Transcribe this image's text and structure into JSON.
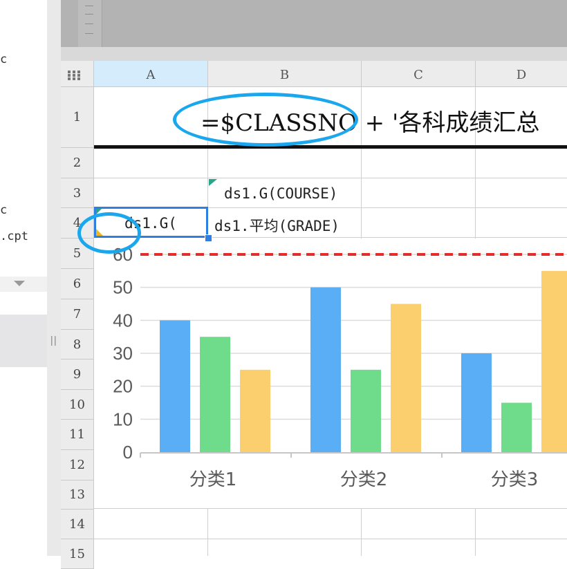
{
  "left_panel": {
    "text_fragments": [
      "c",
      "c",
      ".cpt"
    ]
  },
  "grid": {
    "columns": [
      "A",
      "B",
      "C",
      "D"
    ],
    "rows": [
      "1",
      "2",
      "3",
      "4",
      "5",
      "6",
      "7",
      "8",
      "9",
      "10",
      "11",
      "12",
      "13",
      "14",
      "15"
    ],
    "selected_column": "A",
    "cells": {
      "A1": "=$CLASSNO + '各科成绩汇总",
      "B3": "ds1.G(COURSE)",
      "A4": "ds1.G(",
      "B4": "ds1.平均(GRADE)"
    }
  },
  "chart_data": {
    "type": "bar",
    "categories": [
      "分类1",
      "分类2",
      "分类3"
    ],
    "series": [
      {
        "color": "#5aaef5",
        "values": [
          40,
          50,
          30
        ]
      },
      {
        "color": "#6fdc8c",
        "values": [
          35,
          25,
          15
        ]
      },
      {
        "color": "#fbcf6e",
        "values": [
          25,
          45,
          55
        ]
      }
    ],
    "yticks": [
      "0",
      "10",
      "20",
      "30",
      "40",
      "50",
      "60"
    ],
    "ylim": [
      0,
      60
    ],
    "reference_line": {
      "value": 60,
      "color": "#e52b2b",
      "style": "dashed"
    },
    "grid": true
  },
  "colors": {
    "annotation_oval": "#1aa7ee",
    "selection": "#2f7fe0",
    "header_bg": "#ececec",
    "selected_header_bg": "#d4ecfb"
  }
}
